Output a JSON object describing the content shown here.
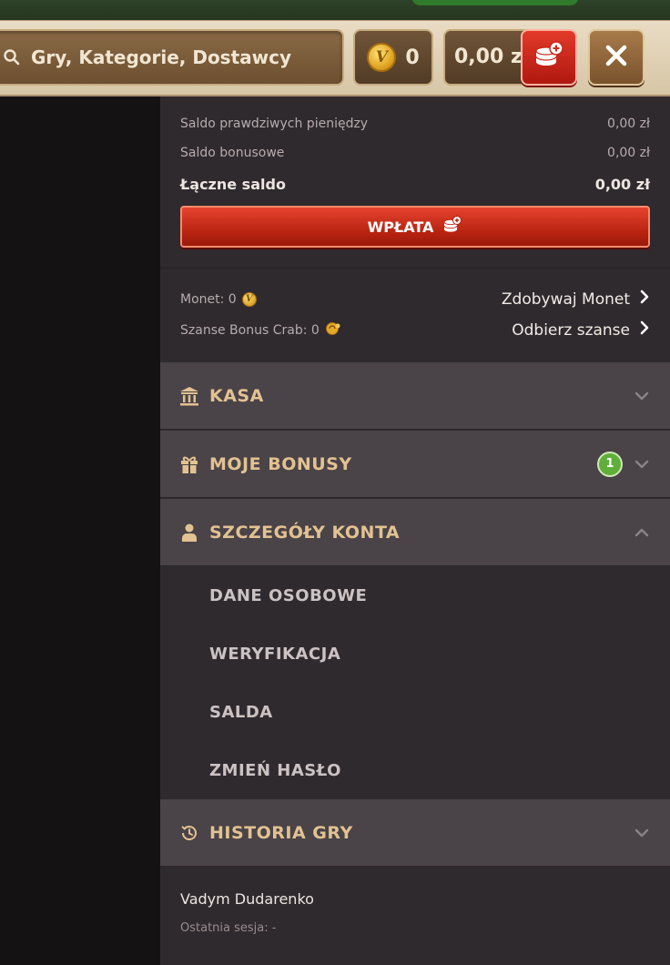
{
  "header": {
    "search_placeholder": "Gry, Kategorie, Dostawcy",
    "coin_symbol": "V",
    "coins": "0",
    "balance": "0,00 zł"
  },
  "wallet": {
    "real_money_label": "Saldo prawdziwych pieniędzy",
    "real_money_value": "0,00 zł",
    "bonus_label": "Saldo bonusowe",
    "bonus_value": "0,00 zł",
    "total_label": "Łączne saldo",
    "total_value": "0,00 zł",
    "deposit_label": "WPŁATA"
  },
  "extras": {
    "coins_label": "Monet: 0",
    "coins_link": "Zdobywaj Monet",
    "crab_label": "Szanse Bonus Crab: 0",
    "crab_link": "Odbierz szanse"
  },
  "sections": [
    {
      "title": "KASA",
      "icon": "bank-icon",
      "expanded": false
    },
    {
      "title": "MOJE BONUSY",
      "icon": "gift-icon",
      "badge": "1",
      "expanded": false
    },
    {
      "title": "SZCZEGÓŁY KONTA",
      "icon": "user-icon",
      "expanded": true
    },
    {
      "title": "HISTORIA GRY",
      "icon": "history-icon",
      "expanded": false
    }
  ],
  "account_items": [
    "DANE OSOBOWE",
    "WERYFIKACJA",
    "SALDA",
    "ZMIEŃ HASŁO"
  ],
  "user": {
    "name": "Vadym Dudarenko",
    "last_session": "Ostatnia sesja: -"
  },
  "colors": {
    "accent_gold": "#e2c292",
    "deposit_red": "#c8281a",
    "badge_green": "#5fae3a",
    "panel_bg": "#2f2a2e",
    "section_bg": "#4a4347"
  }
}
